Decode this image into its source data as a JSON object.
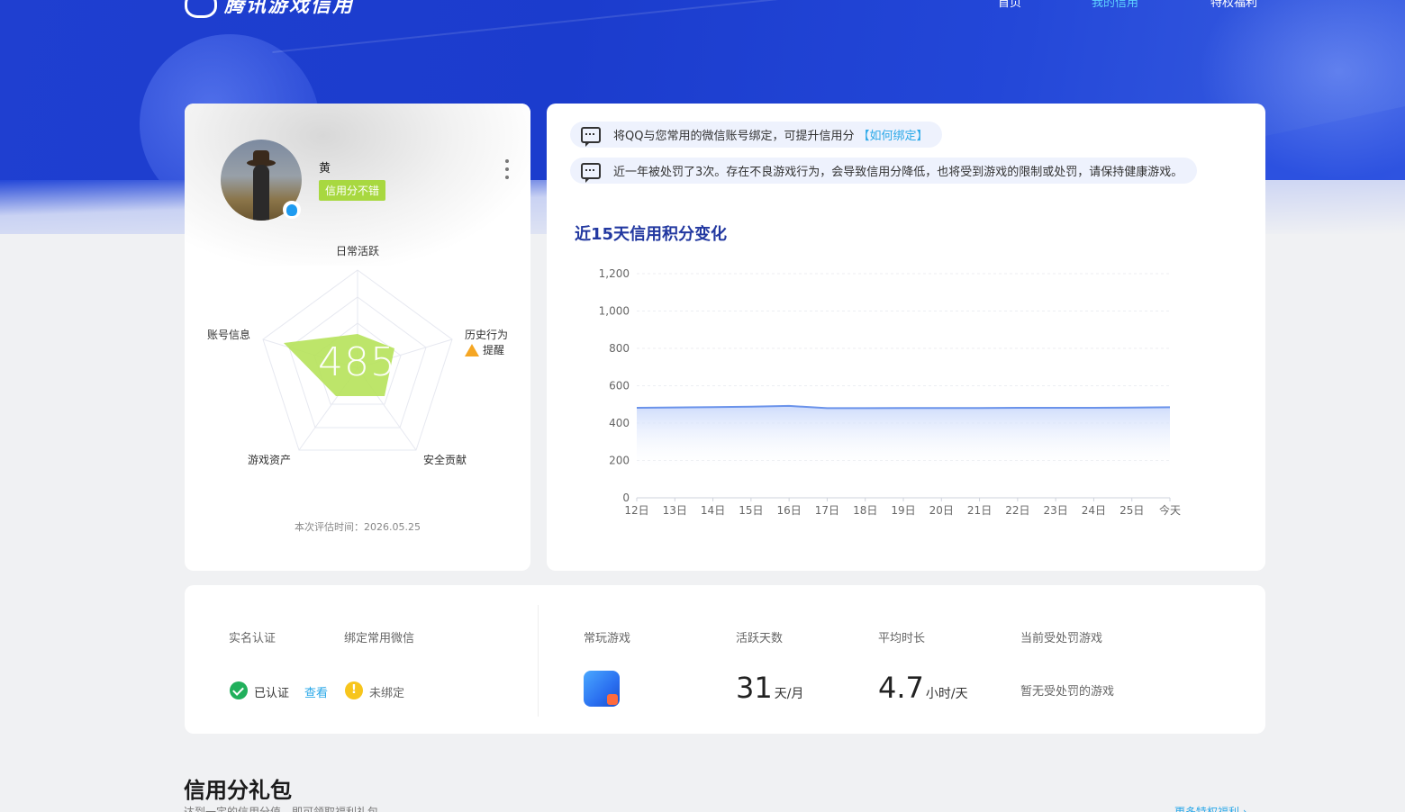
{
  "header": {
    "logo_text": "腾讯游戏信用",
    "nav": [
      "首页",
      "我的信用",
      "特权福利"
    ],
    "active_nav": "我的信用"
  },
  "profile": {
    "username": "黄",
    "credit_tag": "信用分不错",
    "score": "485",
    "radar_axes": [
      "日常活跃",
      "历史行为",
      "安全贡献",
      "游戏资产",
      "账号信息"
    ],
    "warning_label": "提醒",
    "eval_time": "本次评估时间：2026.05.25"
  },
  "notices": [
    {
      "text": "将QQ与您常用的微信账号绑定，可提升信用分",
      "link": "【如何绑定】"
    },
    {
      "text": "近一年被处罚了3次。存在不良游戏行为，会导致信用分降低，也将受到游戏的限制或处罚，请保持健康游戏。",
      "link": ""
    },
    {
      "text": "",
      "link": ""
    }
  ],
  "chart_title": "近15天信用积分变化",
  "chart_data": {
    "type": "area",
    "title": "近15天信用积分变化",
    "categories": [
      "12日",
      "13日",
      "14日",
      "15日",
      "16日",
      "17日",
      "18日",
      "19日",
      "20日",
      "21日",
      "22日",
      "23日",
      "24日",
      "25日",
      "今天"
    ],
    "values": [
      482,
      484,
      486,
      488,
      492,
      480,
      480,
      481,
      481,
      481,
      482,
      482,
      482,
      483,
      485
    ],
    "ylim": [
      0,
      1200
    ],
    "yticks": [
      0,
      200,
      400,
      600,
      800,
      1000,
      1200
    ],
    "ytick_labels": [
      "0",
      "200",
      "400",
      "600",
      "800",
      "1,000",
      "1,200"
    ],
    "color": "#6b93ea",
    "grid": true
  },
  "stats": {
    "realname_label": "实名认证",
    "realname_status": "已认证",
    "realname_link": "查看",
    "wechat_label": "绑定常用微信",
    "wechat_status": "未绑定",
    "games_label": "常玩游戏",
    "active_days_label": "活跃天数",
    "active_days_value": "31",
    "active_days_unit": "天/月",
    "avg_time_label": "平均时长",
    "avg_time_value": "4.7",
    "avg_time_unit": "小时/天",
    "punished_label": "当前受处罚游戏",
    "punished_value": "暂无受处罚的游戏"
  },
  "gift": {
    "title": "信用分礼包",
    "subtitle": "达到一定的信用分值，即可领取福利礼包",
    "more": "更多特权福利 ›"
  },
  "colors": {
    "brand_blue": "#1f3fd0",
    "credit_green": "#a8d840",
    "link_blue": "#2aa8e8"
  }
}
